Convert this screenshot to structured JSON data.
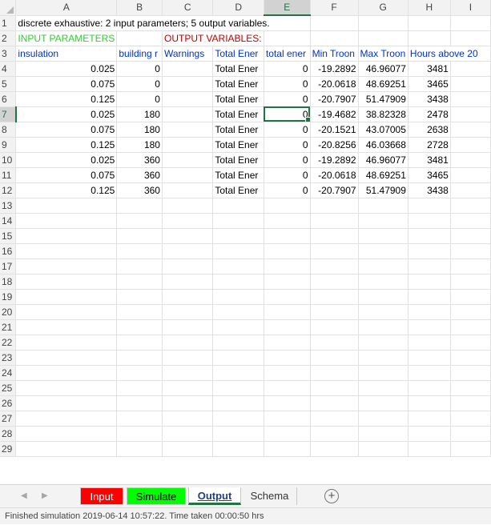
{
  "columns": [
    "A",
    "B",
    "C",
    "D",
    "E",
    "F",
    "G",
    "H",
    "I"
  ],
  "active_column": "E",
  "active_row": 7,
  "row1": {
    "text": "discrete exhaustive: 2 input parameters; 5 output variables."
  },
  "row2": {
    "input_label": "INPUT PARAMETERS",
    "output_label": "OUTPUT VARIABLES:"
  },
  "headers": [
    "insulation",
    "building r",
    "Warnings",
    "Total Ener",
    "total ener",
    "Min Troon",
    "Max Troon",
    "Hours above 20"
  ],
  "data_rows": [
    {
      "row": 4,
      "a": "0.025",
      "b": "0",
      "c": "",
      "d": "Total Ener",
      "e": "0",
      "f": "-19.2892",
      "g": "46.96077",
      "h": "3481"
    },
    {
      "row": 5,
      "a": "0.075",
      "b": "0",
      "c": "",
      "d": "Total Ener",
      "e": "0",
      "f": "-20.0618",
      "g": "48.69251",
      "h": "3465"
    },
    {
      "row": 6,
      "a": "0.125",
      "b": "0",
      "c": "",
      "d": "Total Ener",
      "e": "0",
      "f": "-20.7907",
      "g": "51.47909",
      "h": "3438"
    },
    {
      "row": 7,
      "a": "0.025",
      "b": "180",
      "c": "",
      "d": "Total Ener",
      "e": "0",
      "f": "-19.4682",
      "g": "38.82328",
      "h": "2478"
    },
    {
      "row": 8,
      "a": "0.075",
      "b": "180",
      "c": "",
      "d": "Total Ener",
      "e": "0",
      "f": "-20.1521",
      "g": "43.07005",
      "h": "2638"
    },
    {
      "row": 9,
      "a": "0.125",
      "b": "180",
      "c": "",
      "d": "Total Ener",
      "e": "0",
      "f": "-20.8256",
      "g": "46.03668",
      "h": "2728"
    },
    {
      "row": 10,
      "a": "0.025",
      "b": "360",
      "c": "",
      "d": "Total Ener",
      "e": "0",
      "f": "-19.2892",
      "g": "46.96077",
      "h": "3481"
    },
    {
      "row": 11,
      "a": "0.075",
      "b": "360",
      "c": "",
      "d": "Total Ener",
      "e": "0",
      "f": "-20.0618",
      "g": "48.69251",
      "h": "3465"
    },
    {
      "row": 12,
      "a": "0.125",
      "b": "360",
      "c": "",
      "d": "Total Ener",
      "e": "0",
      "f": "-20.7907",
      "g": "51.47909",
      "h": "3438"
    }
  ],
  "empty_rows": [
    13,
    14,
    15,
    16,
    17,
    18,
    19,
    20,
    21,
    22,
    23,
    24,
    25,
    26,
    27,
    28,
    29
  ],
  "tabs": {
    "input": "Input",
    "simulate": "Simulate",
    "output": "Output",
    "schema": "Schema",
    "add": "+"
  },
  "status": "Finished simulation 2019-06-14 10:57:22. Time taken 00:00:50 hrs",
  "colors": {
    "input_tab": "#ff0000",
    "simulate_tab": "#00ff00",
    "input_label": "#33cc33",
    "output_label": "#c00000",
    "header_text": "#0033cc",
    "selection": "#217346"
  }
}
